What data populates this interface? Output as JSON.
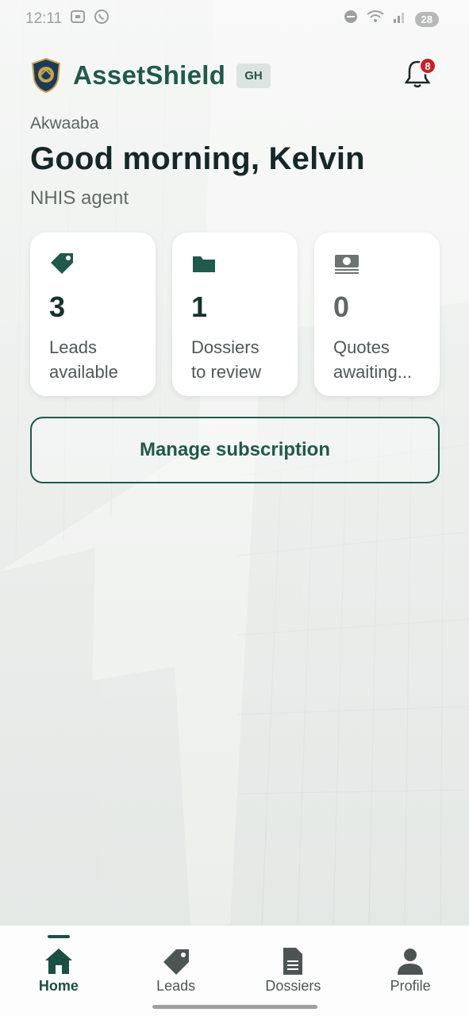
{
  "status_bar": {
    "time": "12:11",
    "battery": "28"
  },
  "header": {
    "app_name": "AssetShield",
    "region": "GH",
    "notification_count": "8"
  },
  "greeting": {
    "small": "Akwaaba",
    "title": "Good morning, Kelvin",
    "role": "NHIS agent"
  },
  "stats": [
    {
      "icon": "tag-icon",
      "value": "3",
      "label_line1": "Leads",
      "label_line2": "available"
    },
    {
      "icon": "folder-icon",
      "value": "1",
      "label_line1": "Dossiers",
      "label_line2": "to review"
    },
    {
      "icon": "money-icon",
      "value": "0",
      "label_line1": "Quotes",
      "label_line2": "awaiting..."
    }
  ],
  "actions": {
    "manage_subscription": "Manage subscription"
  },
  "nav": [
    {
      "label": "Home",
      "icon": "home-icon",
      "active": true
    },
    {
      "label": "Leads",
      "icon": "tag-icon",
      "active": false
    },
    {
      "label": "Dossiers",
      "icon": "document-icon",
      "active": false
    },
    {
      "label": "Profile",
      "icon": "person-icon",
      "active": false
    }
  ],
  "colors": {
    "brand": "#1f5a4c",
    "badge": "#c8202a",
    "card_bg": "#ffffff"
  }
}
